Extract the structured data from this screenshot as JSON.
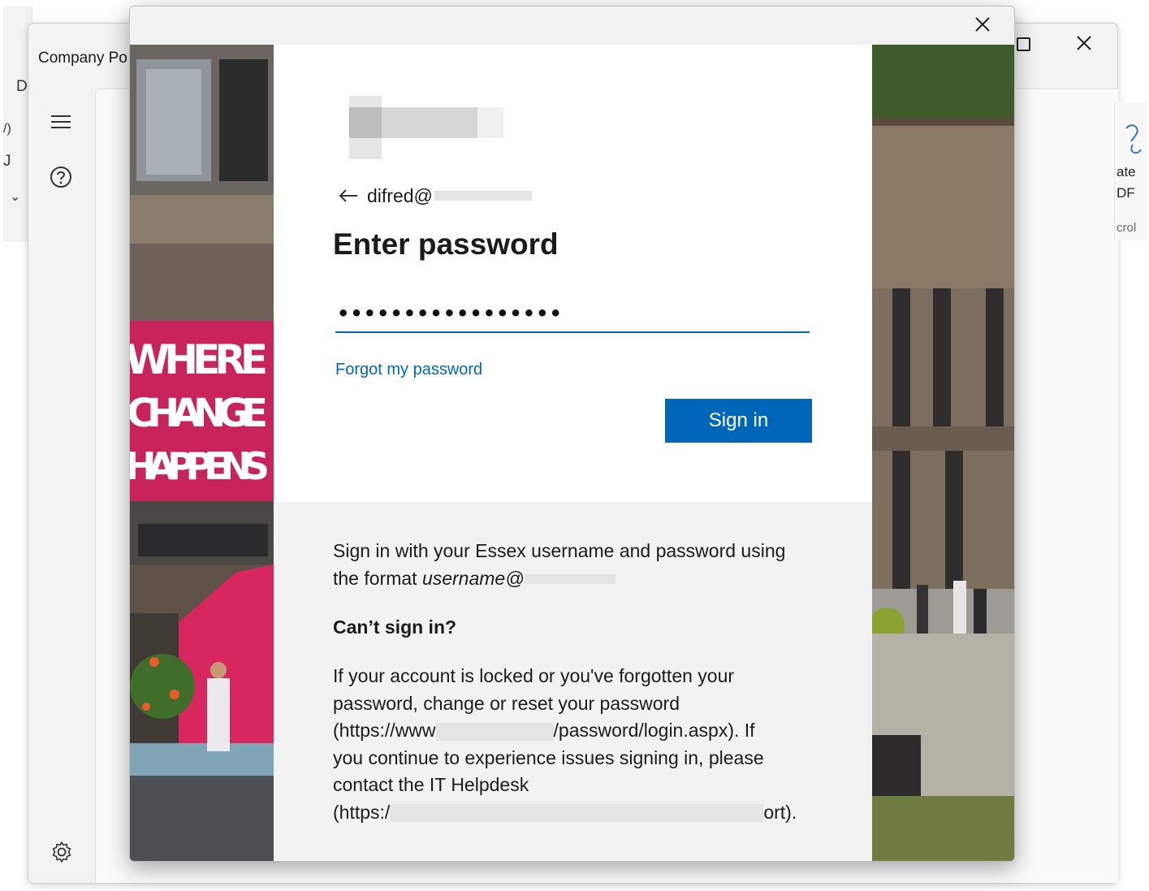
{
  "background_app": {
    "title": "Company Po",
    "left_fragments": [
      "D",
      "/)",
      "J",
      "⌄"
    ],
    "right_fragments": [
      "ate",
      "DF",
      "crol"
    ]
  },
  "dialog": {
    "identity": "difred@",
    "heading": "Enter password",
    "password_value": "•••••••••••••••••",
    "forgot_link": "Forgot my password",
    "sign_in_button": "Sign in",
    "footer": {
      "intro_line1": "Sign in with your Essex username and password using",
      "intro_line2_prefix": "the format ",
      "intro_line2_italic": "username@",
      "cant_heading": "Can’t sign in?",
      "help_line1": "If your account is locked or you've forgotten your",
      "help_line2": "password, change or reset your password",
      "help_line3_prefix": "(https://www",
      "help_line3_suffix": "/password/login.aspx). If",
      "help_line4": "you continue to experience issues signing in, please",
      "help_line5": "contact the IT Helpdesk",
      "help_line6_prefix": "(https:/",
      "help_line6_suffix": "ort)."
    },
    "banner_text": [
      "WHERE",
      "CHANGE",
      "HAPPENS"
    ]
  },
  "icons": {
    "menu": "hamburger-menu-icon",
    "help": "help-circle-icon",
    "settings": "gear-icon",
    "back": "arrow-left-icon",
    "close": "close-icon"
  },
  "colors": {
    "accent": "#0067b8",
    "footer_bg": "#f2f2f2",
    "banner_pink": "#c8235a"
  }
}
